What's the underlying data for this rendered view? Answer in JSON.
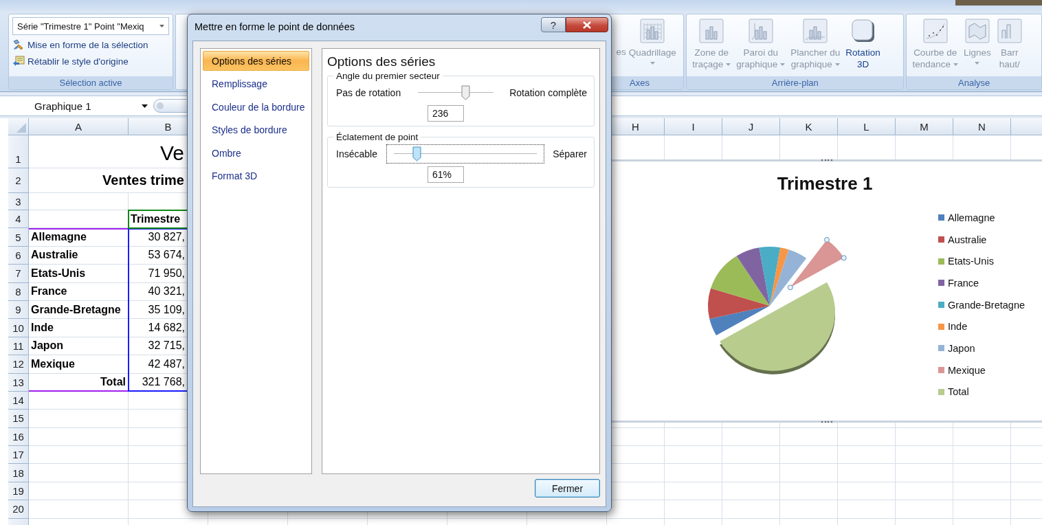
{
  "ribbon": {
    "groups": [
      {
        "kind": "selection",
        "label": "Sélection active",
        "dropdown": "Série \"Trimestre 1\" Point \"Mexiq",
        "buttons": [
          "Mise en forme de la sélection",
          "Rétablir le style d'origine"
        ]
      },
      {
        "kind": "buttons",
        "label": "Axes",
        "buttons": [
          {
            "lines": [
              "es"
            ],
            "disabled": true,
            "dropdown": false
          },
          {
            "lines": [
              "Quadrillage"
            ],
            "disabled": true,
            "dropdown": true
          }
        ]
      },
      {
        "kind": "buttons",
        "label": "Arrière-plan",
        "buttons": [
          {
            "lines": [
              "Zone de",
              "traçage"
            ],
            "disabled": true,
            "dropdown": true
          },
          {
            "lines": [
              "Paroi du",
              "graphique"
            ],
            "disabled": true,
            "dropdown": true
          },
          {
            "lines": [
              "Plancher du",
              "graphique"
            ],
            "disabled": true,
            "dropdown": true
          },
          {
            "lines": [
              "Rotation",
              "3D"
            ],
            "disabled": false,
            "dropdown": false
          }
        ]
      },
      {
        "kind": "buttons",
        "label": "Analyse",
        "buttons": [
          {
            "lines": [
              "Courbe de",
              "tendance"
            ],
            "disabled": true,
            "dropdown": true
          },
          {
            "lines": [
              "Lignes"
            ],
            "disabled": true,
            "dropdown": true
          },
          {
            "lines": [
              "Barr",
              "haut/"
            ],
            "disabled": true,
            "dropdown": false
          }
        ]
      }
    ]
  },
  "name_box": "Graphique 1",
  "sheet": {
    "columns": [
      "A",
      "B",
      "H",
      "I",
      "J",
      "K",
      "L",
      "M",
      "N"
    ],
    "rows": [
      {
        "header": "1",
        "kind": "title",
        "text": "Ve"
      },
      {
        "header": "2",
        "kind": "subtitle",
        "text": "Ventes trime"
      },
      {
        "header": "3",
        "kind": "empty"
      },
      {
        "header": "4",
        "kind": "column-title",
        "value": "Trimestre"
      },
      {
        "header": "5",
        "kind": "data",
        "label": "Allemagne",
        "value": "30 827,"
      },
      {
        "header": "6",
        "kind": "data",
        "label": "Australie",
        "value": "53 674,"
      },
      {
        "header": "7",
        "kind": "data",
        "label": "Etats-Unis",
        "value": "71 950,"
      },
      {
        "header": "8",
        "kind": "data",
        "label": "France",
        "value": "40 321,"
      },
      {
        "header": "9",
        "kind": "data",
        "label": "Grande-Bretagne",
        "value": "35 109,"
      },
      {
        "header": "10",
        "kind": "data",
        "label": "Inde",
        "value": "14 682,"
      },
      {
        "header": "11",
        "kind": "data",
        "label": "Japon",
        "value": "32 715,"
      },
      {
        "header": "12",
        "kind": "data",
        "label": "Mexique",
        "value": "42 487,"
      },
      {
        "header": "13",
        "kind": "total",
        "label": "Total",
        "value": "321 768,"
      },
      {
        "header": "14",
        "kind": "empty"
      },
      {
        "header": "15",
        "kind": "empty"
      },
      {
        "header": "16",
        "kind": "empty"
      },
      {
        "header": "17",
        "kind": "empty"
      },
      {
        "header": "18",
        "kind": "empty"
      },
      {
        "header": "19",
        "kind": "empty"
      },
      {
        "header": "20",
        "kind": "empty"
      }
    ]
  },
  "chart": {
    "title": "Trimestre 1",
    "legend": [
      {
        "label": "Allemagne",
        "color": "#4f81bd"
      },
      {
        "label": "Australie",
        "color": "#c0504d"
      },
      {
        "label": "Etats-Unis",
        "color": "#9bbb59"
      },
      {
        "label": "France",
        "color": "#8064a2"
      },
      {
        "label": "Grande-Bretagne",
        "color": "#4bacc6"
      },
      {
        "label": "Inde",
        "color": "#f79646"
      },
      {
        "label": "Japon",
        "color": "#95b3d7"
      },
      {
        "label": "Mexique",
        "color": "#d99694"
      },
      {
        "label": "Total",
        "color": "#b8cc8e"
      }
    ]
  },
  "dialog": {
    "title": "Mettre en forme le point de données",
    "help": "?",
    "nav": [
      {
        "label": "Options des séries",
        "selected": true
      },
      {
        "label": "Remplissage",
        "selected": false
      },
      {
        "label": "Couleur de la bordure",
        "selected": false
      },
      {
        "label": "Styles de bordure",
        "selected": false
      },
      {
        "label": "Ombre",
        "selected": false
      },
      {
        "label": "Format 3D",
        "selected": false
      }
    ],
    "heading": "Options des séries",
    "sections": [
      {
        "legend": "Angle du premier secteur",
        "left": "Pas de rotation",
        "right": "Rotation complète",
        "level": 0.63,
        "value": "236",
        "focused": false
      },
      {
        "legend": "Éclatement de point",
        "left": "Insécable",
        "right": "Séparer",
        "level": 0.16,
        "value": "61%",
        "focused": true
      }
    ],
    "close_button": "Fermer"
  }
}
